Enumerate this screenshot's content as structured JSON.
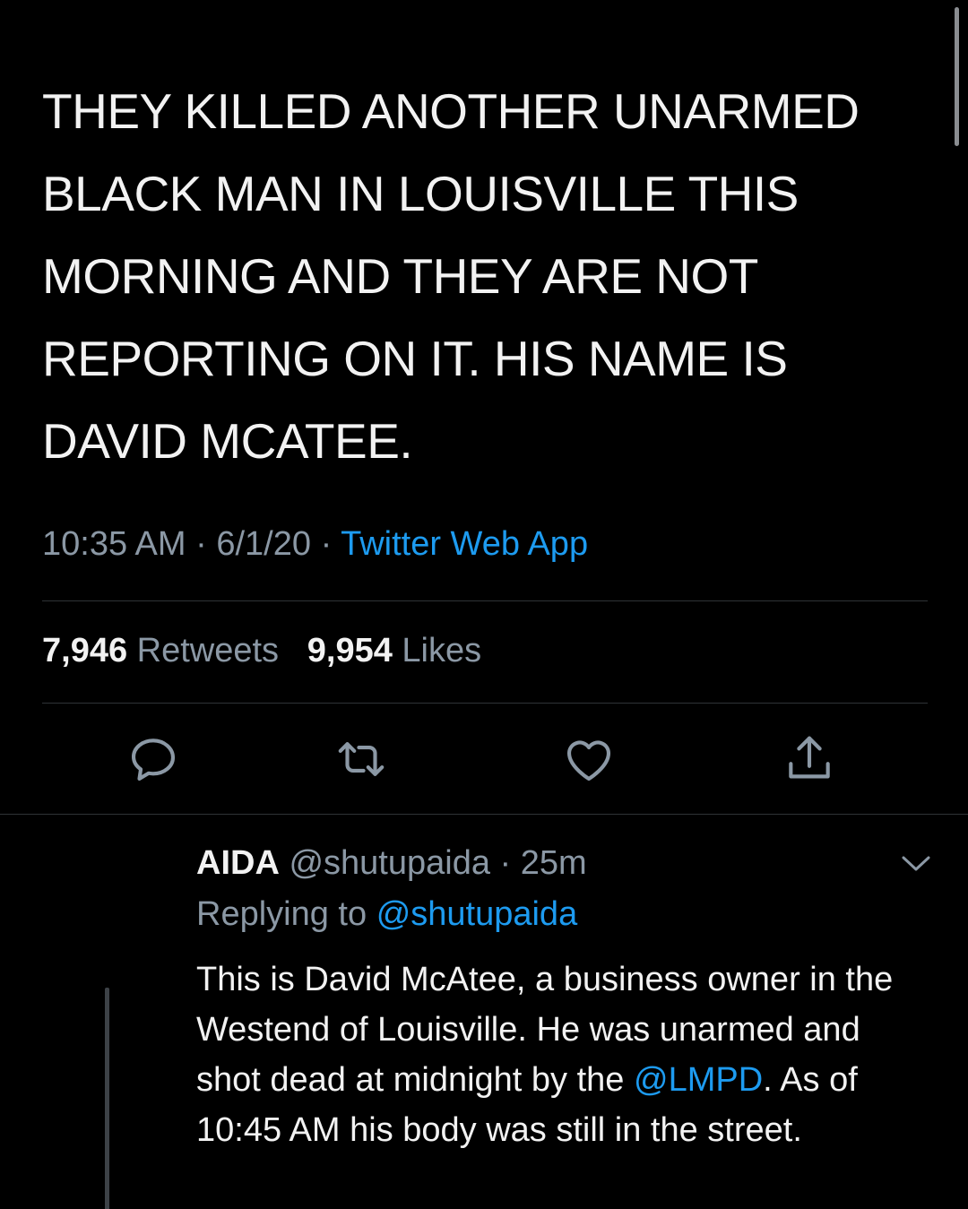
{
  "tweet": {
    "text": "THEY KILLED ANOTHER UNARMED BLACK MAN IN LOUISVILLE THIS MORNING AND THEY ARE NOT REPORTING ON IT. HIS NAME IS DAVID MCATEE.",
    "time": "10:35 AM",
    "date": "6/1/20",
    "source": "Twitter Web App",
    "separator": "·"
  },
  "stats": {
    "retweets_count": "7,946",
    "retweets_label": "Retweets",
    "likes_count": "9,954",
    "likes_label": "Likes"
  },
  "actions": {
    "icons": [
      "reply-icon",
      "retweet-icon",
      "like-icon",
      "share-icon"
    ]
  },
  "reply": {
    "name": "AIDA",
    "handle": "@shutupaida",
    "separator": "·",
    "age": "25m",
    "replying_prefix": "Replying to",
    "replying_handle": "@shutupaida",
    "text_part1": "This is David McAtee, a business owner in the Westend of Louisville. He was unarmed and shot dead at midnight by the ",
    "mention": "@LMPD",
    "text_part2": ". As of 10:45 AM his body was still in the street."
  },
  "colors": {
    "background": "#000000",
    "text": "#f2f2f2",
    "muted": "#8b98a5",
    "link": "#1d9bf0",
    "divider": "#2f3336"
  }
}
